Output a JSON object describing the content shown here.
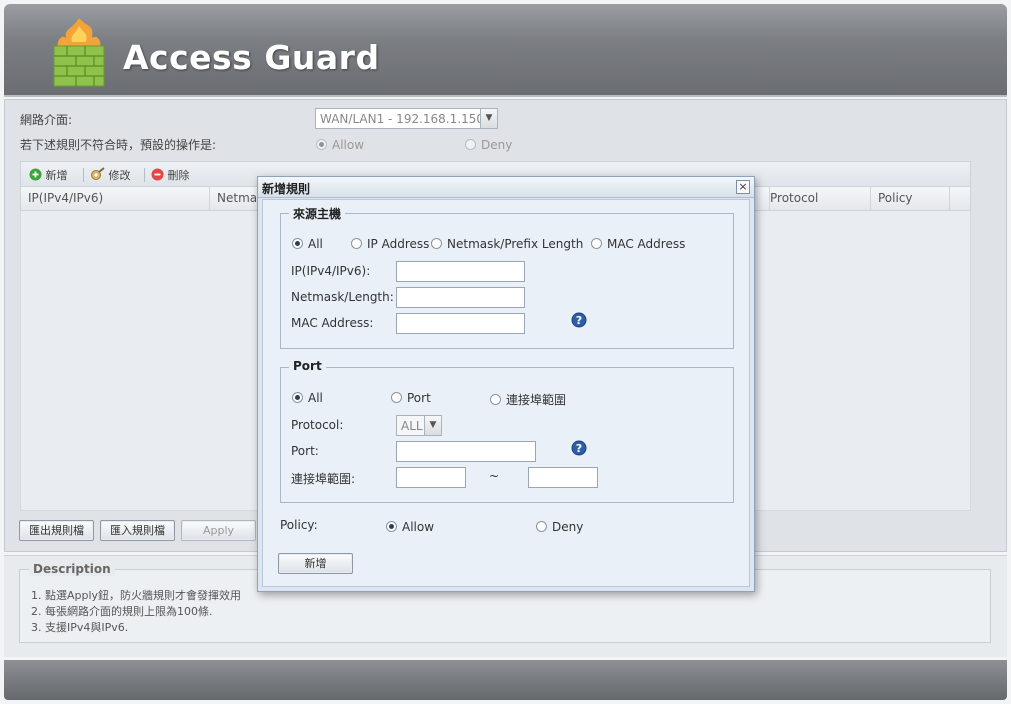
{
  "app": {
    "title": "Access Guard"
  },
  "settings": {
    "interface_label": "網路介面:",
    "interface_value": "WAN/LAN1 - 192.168.1.150",
    "default_action_label": "若下述規則不符合時，預設的操作是:",
    "default_action_options": [
      "Allow",
      "Deny"
    ],
    "default_action_selected": "Allow"
  },
  "toolbar": {
    "add": "新增",
    "edit": "修改",
    "delete": "刪除"
  },
  "table": {
    "columns": [
      "IP(IPv4/IPv6)",
      "Netmas",
      "Protocol",
      "Policy"
    ]
  },
  "buttons": {
    "export": "匯出規則檔",
    "import": "匯入規則檔",
    "apply": "Apply"
  },
  "description": {
    "title": "Description",
    "lines": [
      "1. 點選Apply鈕，防火牆規則才會發揮效用",
      "2. 每張網路介面的規則上限為100條.",
      "3. 支援IPv4與IPv6."
    ]
  },
  "dialog": {
    "title": "新增規則",
    "close": "×",
    "source": {
      "legend": "來源主機",
      "options": [
        "All",
        "IP Address",
        "Netmask/Prefix Length",
        "MAC Address"
      ],
      "selected": "All",
      "ip_label": "IP(IPv4/IPv6):",
      "netmask_label": "Netmask/Length:",
      "mac_label": "MAC Address:"
    },
    "port": {
      "legend": "Port",
      "options": [
        "All",
        "Port",
        "連接埠範圍"
      ],
      "selected": "All",
      "protocol_label": "Protocol:",
      "protocol_value": "ALL",
      "port_label": "Port:",
      "range_label": "連接埠範圍:",
      "range_sep": "~"
    },
    "policy": {
      "label": "Policy:",
      "options": [
        "Allow",
        "Deny"
      ],
      "selected": "Allow"
    },
    "submit": "新增"
  },
  "icons": {
    "logo": "firewall-shield-icon",
    "add": "add-circle-icon",
    "edit": "edit-gear-icon",
    "delete": "delete-circle-icon",
    "help": "help-question-icon",
    "dropdown": "chevron-down-icon"
  },
  "colors": {
    "header": "#7b7e83",
    "dialog_bg": "#e9f0f8",
    "delete": "#e04848",
    "add": "#3aa63a"
  }
}
